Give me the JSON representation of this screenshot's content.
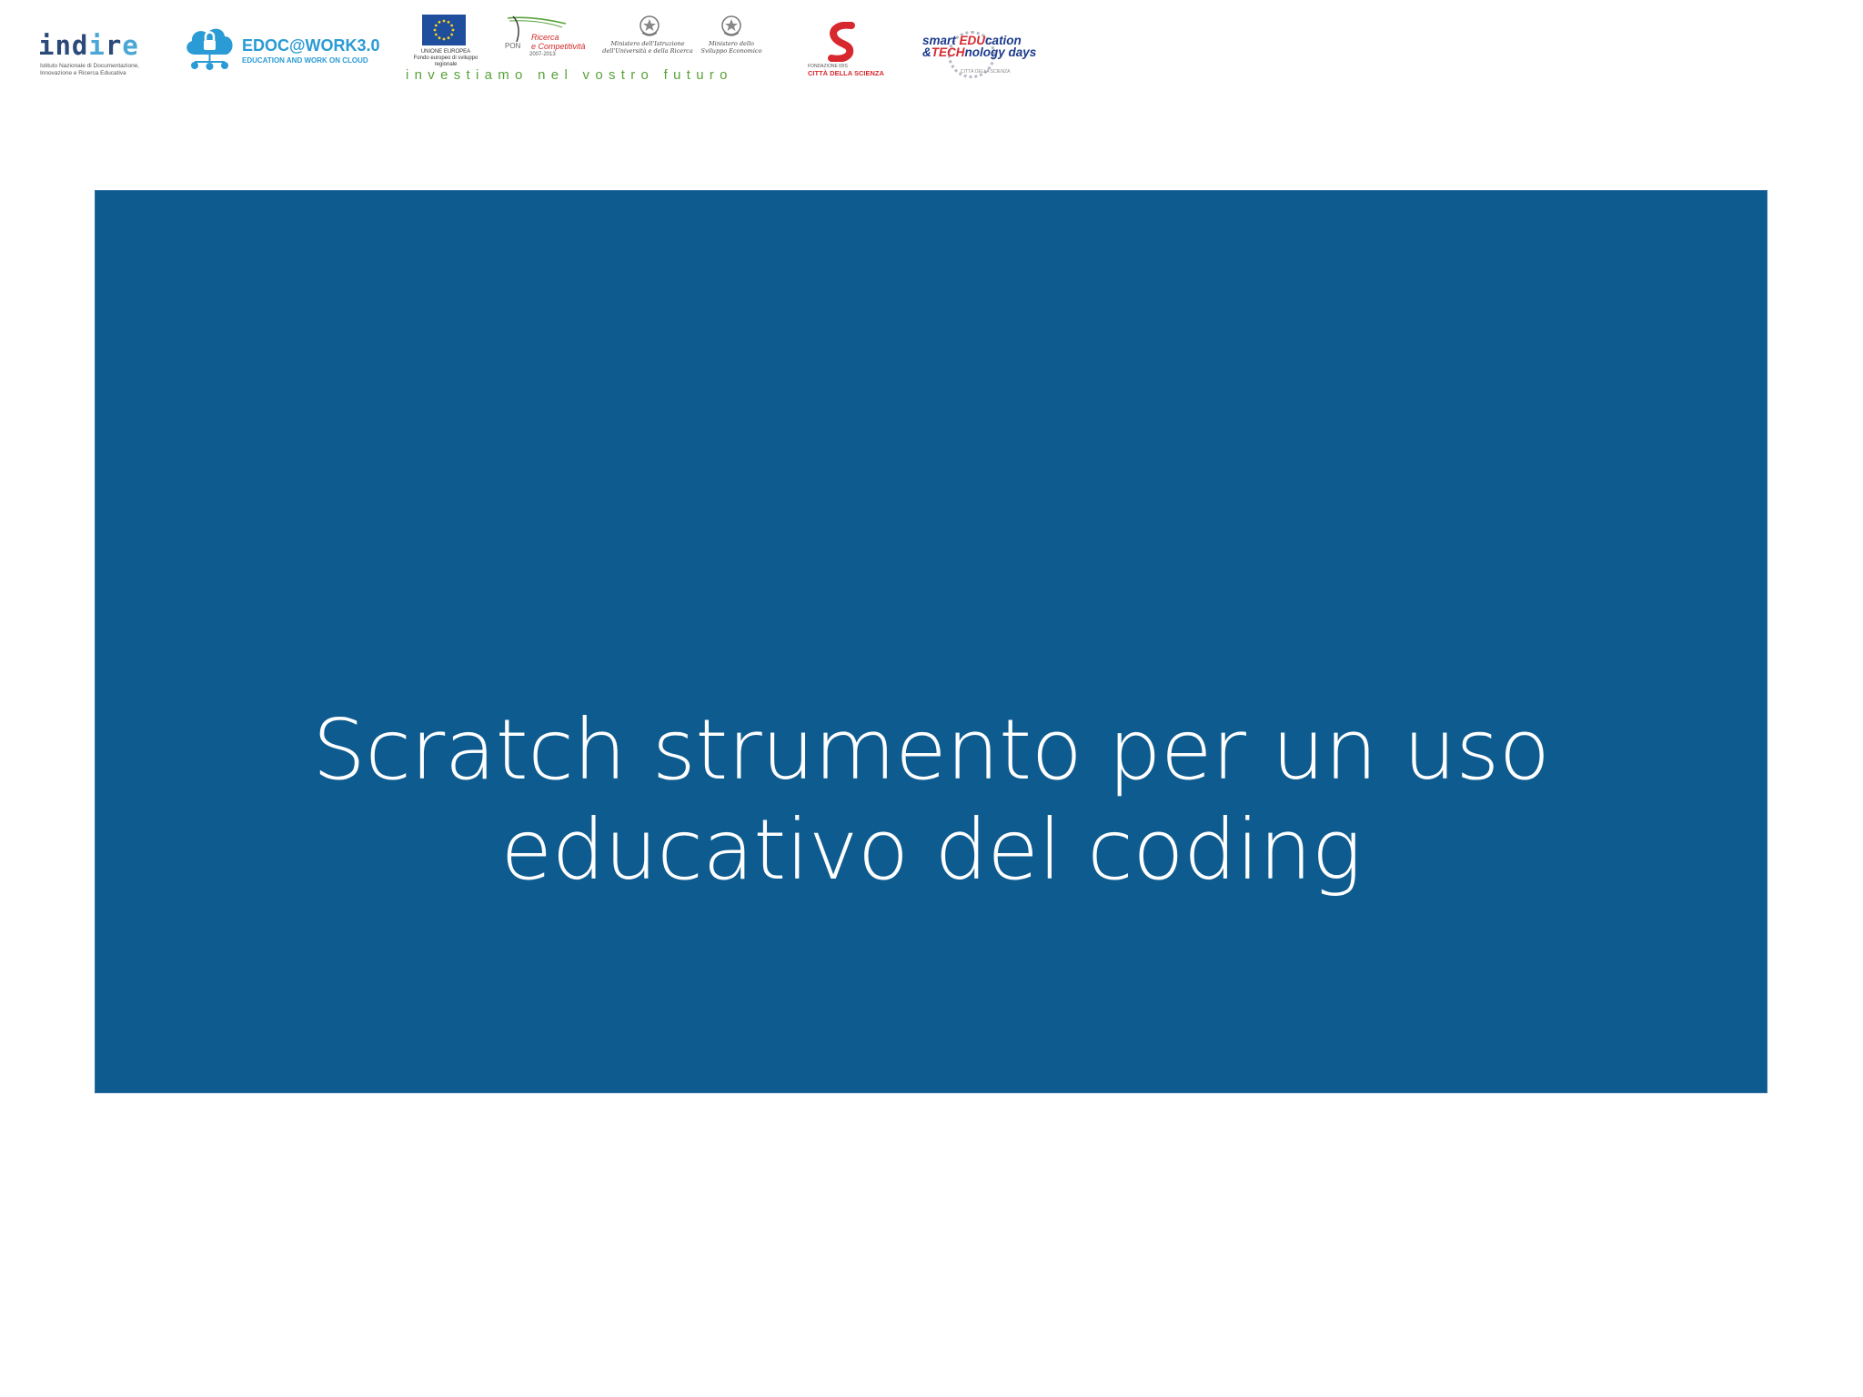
{
  "logos": {
    "indire": {
      "name": "indire",
      "subtitle": "Istituto Nazionale di Documentazione, Innovazione e Ricerca Educativa"
    },
    "edoc": {
      "title": "EDOC@WORK3.0",
      "tagline": "EDUCATION AND WORK ON CLOUD"
    },
    "eu": {
      "caption_line1": "UNIONE EUROPEA",
      "caption_line2": "Fondo europeo di sviluppo regionale",
      "pon_letters": "PON",
      "pon_title": "Ricerca\ne Competitività",
      "pon_years": "2007-2013",
      "ministry1": "Ministero dell'Istruzione dell'Università e della Ricerca",
      "ministry2": "Ministero dello Sviluppo Economico",
      "slogan": "investiamo nel vostro futuro"
    },
    "citta_scienza": {
      "small": "FONDAZIONE IDIS",
      "name": "CITTÀ DELLA SCIENZA"
    },
    "smart_edu": {
      "line1_a": "smart ",
      "line1_b": "EDU",
      "line1_c": "cation",
      "line2_a": "&",
      "line2_b": "TECH",
      "line2_c": "nology days",
      "sub": "CITTÀ DELLA SCIENZA"
    }
  },
  "slide": {
    "title_line1": "Scratch strumento per un uso",
    "title_line2": "educativo del coding"
  },
  "colors": {
    "panel": "#0e5b8f",
    "title_text": "#ffffff",
    "slogan": "#58a23a"
  }
}
